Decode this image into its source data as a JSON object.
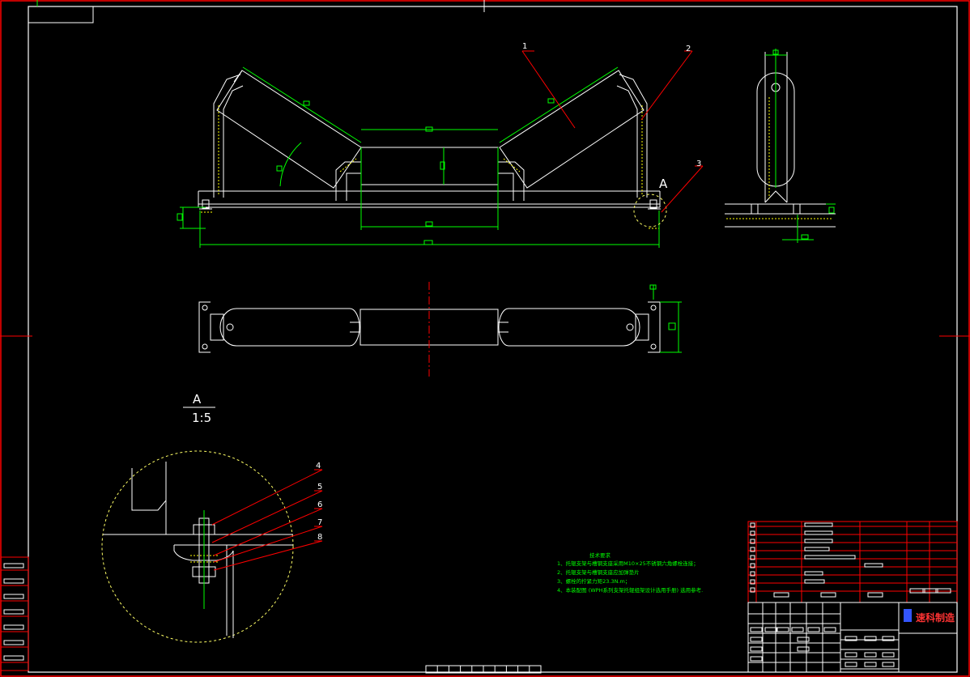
{
  "callouts": {
    "c1": "1",
    "c2": "2",
    "c3": "3",
    "c4": "4",
    "c5": "5",
    "c6": "6",
    "c7": "7",
    "c8": "8"
  },
  "section": {
    "letter": "A",
    "scale": "1:5"
  },
  "tech_notes": {
    "title": "技术要求",
    "lines": [
      "1、托辊支架与槽钢支座采用M10×25不锈钢六角螺栓连接；",
      "2、托辊支架与槽钢支座应加弹垫片",
      "3、螺栓的拧紧力矩23.3N.m；",
      "4、本装配图 (WPH系列支架托辊组架设计选用手册) 选用参考."
    ]
  },
  "title_block": {
    "company": "速科制造"
  },
  "colors": {
    "background": "#000000",
    "outline": "#ffffff",
    "frame": "#ff0000",
    "dimension": "#00ff00",
    "circle": "#ffff66",
    "weld": "#ffff00",
    "company_text": "#ff3333",
    "logo": "#3355ff"
  }
}
